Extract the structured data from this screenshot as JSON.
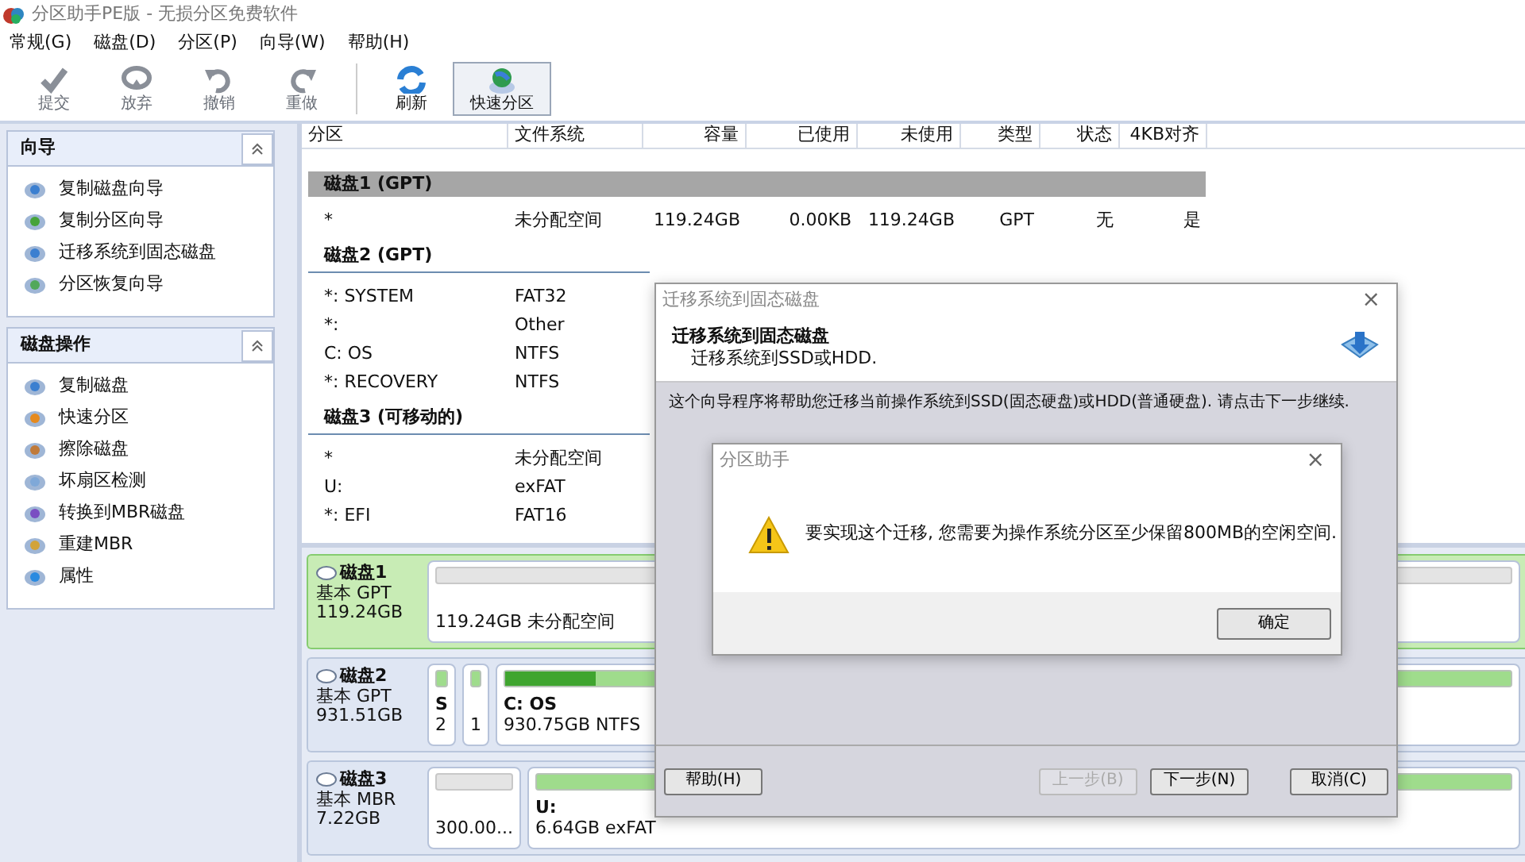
{
  "window": {
    "title": "分区助手PE版 - 无损分区免费软件"
  },
  "menu": [
    "常规(G)",
    "磁盘(D)",
    "分区(P)",
    "向导(W)",
    "帮助(H)"
  ],
  "toolbar": [
    [
      {
        "label": "提交",
        "disabled": true,
        "highlighted": false
      },
      {
        "label": "放弃",
        "disabled": true,
        "highlighted": false
      },
      {
        "label": "撤销",
        "disabled": true,
        "highlighted": false
      },
      {
        "label": "重做",
        "disabled": true,
        "highlighted": false
      }
    ],
    [
      {
        "label": "刷新",
        "disabled": false,
        "highlighted": false
      },
      {
        "label": "快速分区",
        "disabled": false,
        "highlighted": true
      }
    ]
  ],
  "sidebar": [
    {
      "title": "向导",
      "items": [
        "复制磁盘向导",
        "复制分区向导",
        "迁移系统到固态磁盘",
        "分区恢复向导"
      ]
    },
    {
      "title": "磁盘操作",
      "items": [
        "复制磁盘",
        "快速分区",
        "擦除磁盘",
        "坏扇区检测",
        "转换到MBR磁盘",
        "重建MBR",
        "属性"
      ]
    }
  ],
  "table": {
    "columns": [
      "分区",
      "文件系统",
      "容量",
      "已使用",
      "未使用",
      "类型",
      "状态",
      "4KB对齐"
    ],
    "groups": [
      {
        "title": "磁盘1 (GPT)",
        "selected": true,
        "rows": [
          [
            "*",
            "未分配空间",
            "119.24GB",
            "0.00KB",
            "119.24GB",
            "GPT",
            "无",
            "是"
          ]
        ]
      },
      {
        "title": "磁盘2 (GPT)",
        "selected": false,
        "rows": [
          [
            "*: SYSTEM",
            "FAT32"
          ],
          [
            "*:",
            "Other"
          ],
          [
            "C: OS",
            "NTFS"
          ],
          [
            "*: RECOVERY",
            "NTFS"
          ]
        ]
      },
      {
        "title": "磁盘3 (可移动的)",
        "selected": false,
        "rows": [
          [
            "*",
            "未分配空间"
          ],
          [
            "U:",
            "exFAT"
          ],
          [
            "*: EFI",
            "FAT16"
          ]
        ]
      }
    ]
  },
  "disk_map": [
    {
      "name": "磁盘1",
      "type": "基本 GPT",
      "size": "119.24GB",
      "selected": true,
      "partitions": [
        {
          "detail": "119.24GB 未分配空间",
          "kind": "unallocated"
        }
      ]
    },
    {
      "name": "磁盘2",
      "type": "基本 GPT",
      "size": "931.51GB",
      "selected": false,
      "partitions": [
        {
          "label": "S",
          "detail": "2",
          "kind": "allocated"
        },
        {
          "detail": "1",
          "kind": "allocated"
        },
        {
          "label": "C: OS",
          "detail": "930.75GB NTFS",
          "kind": "allocated",
          "level": 0.09
        }
      ]
    },
    {
      "name": "磁盘3",
      "type": "基本 MBR",
      "size": "7.22GB",
      "selected": false,
      "partitions": [
        {
          "detail": "300.00...",
          "kind": "unallocated"
        },
        {
          "label": "U:",
          "detail": "6.64GB exFAT",
          "kind": "allocated"
        }
      ]
    }
  ],
  "wizard": {
    "title": "迁移系统到固态磁盘",
    "close_label": "×",
    "heading": "迁移系统到固态磁盘",
    "subheading": "迁移系统到SSD或HDD.",
    "body": "这个向导程序将帮助您迁移当前操作系统到SSD(固态硬盘)或HDD(普通硬盘). 请点击下一步继续.",
    "help_button": {
      "label": "帮助(H)",
      "disabled": false
    },
    "buttons": [
      {
        "label": "上一步(B)",
        "disabled": true
      },
      {
        "label": "下一步(N)",
        "disabled": false
      },
      {
        "label": "取消(C)",
        "disabled": false
      }
    ]
  },
  "message_box": {
    "title": "分区助手",
    "close_label": "×",
    "message": "要实现这个迁移, 您需要为操作系统分区至少保留800MB的空闲空间.",
    "buttons": [
      {
        "label": "确定",
        "disabled": false
      }
    ]
  }
}
